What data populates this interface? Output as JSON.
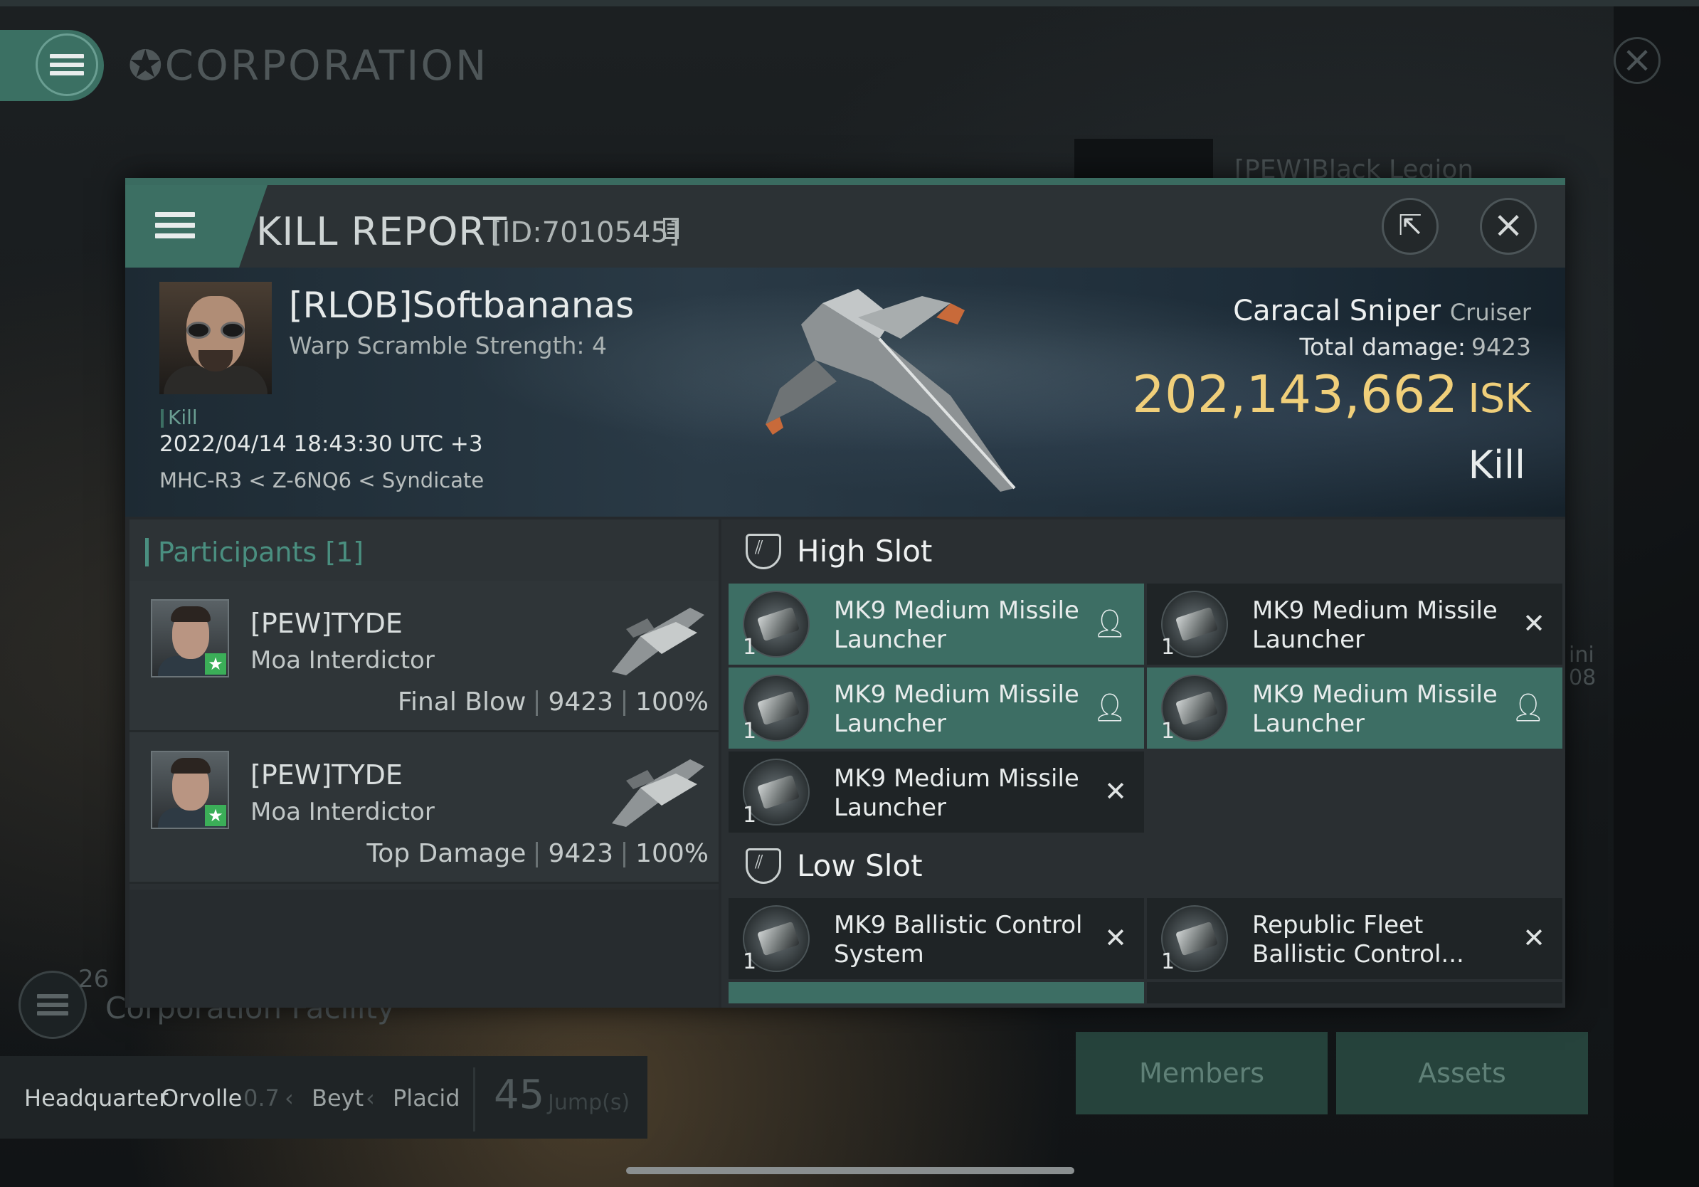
{
  "background": {
    "corp_title": "CORPORATION",
    "legion_text": "[PEW]Black Legion",
    "side_text": [
      "ini",
      "08"
    ],
    "facility_count": "26",
    "facility_label": "Corporation Facility",
    "hq_label": "Headquarter",
    "hq_system": "Orvolle",
    "hq_security": "0.7",
    "hq_constellation": "Beyt",
    "hq_region": "Placid",
    "hq_jumps": "45",
    "hq_jumps_unit": "Jump(s)",
    "members_button": "Members",
    "assets_button": "Assets"
  },
  "modal": {
    "title": "KILL REPORT",
    "report_id": "[ID:7010545]",
    "victim": {
      "name": "[RLOB]Softbananas",
      "warp_scramble": "Warp Scramble Strength: 4",
      "tag": "Kill",
      "date": "2022/04/14 18:43:30 UTC +3",
      "location": "MHC-R3 < Z-6NQ6 < Syndicate"
    },
    "ship": {
      "name": "Caracal Sniper",
      "class": "Cruiser",
      "total_damage_label": "Total damage:",
      "total_damage": "9423",
      "value": "202,143,662",
      "currency": "ISK",
      "result": "Kill"
    },
    "participants_title": "Participants [1]",
    "participants": [
      {
        "name": "[PEW]TYDE",
        "ship": "Moa Interdictor",
        "role": "Final Blow",
        "damage": "9423",
        "percent": "100%"
      },
      {
        "name": "[PEW]TYDE",
        "ship": "Moa Interdictor",
        "role": "Top Damage",
        "damage": "9423",
        "percent": "100%"
      }
    ],
    "high_slot_label": "High Slot",
    "high_slots": [
      {
        "name": "MK9 Medium Missile Launcher",
        "qty": "1",
        "status": "dropped"
      },
      {
        "name": "MK9 Medium Missile Launcher",
        "qty": "1",
        "status": "destroyed"
      },
      {
        "name": "MK9 Medium Missile Launcher",
        "qty": "1",
        "status": "dropped"
      },
      {
        "name": "MK9 Medium Missile Launcher",
        "qty": "1",
        "status": "dropped"
      },
      {
        "name": "MK9 Medium Missile Launcher",
        "qty": "1",
        "status": "destroyed"
      }
    ],
    "low_slot_label": "Low Slot",
    "low_slots": [
      {
        "name": "MK9 Ballistic Control System",
        "qty": "1",
        "status": "destroyed"
      },
      {
        "name": "Republic Fleet Ballistic Control...",
        "qty": "1",
        "status": "destroyed"
      }
    ]
  },
  "colors": {
    "accent": "#3c6f63",
    "isk_gold": "#f0cf7a",
    "dropped_item_bg": "#3d6e64",
    "destroyed_item_bg": "#1f2426"
  },
  "icons": {
    "menu": "hamburger-icon",
    "share": "external-link-icon",
    "close": "close-icon",
    "dropped": "pilot-icon",
    "destroyed": "x-icon",
    "slot": "shield-icon"
  }
}
